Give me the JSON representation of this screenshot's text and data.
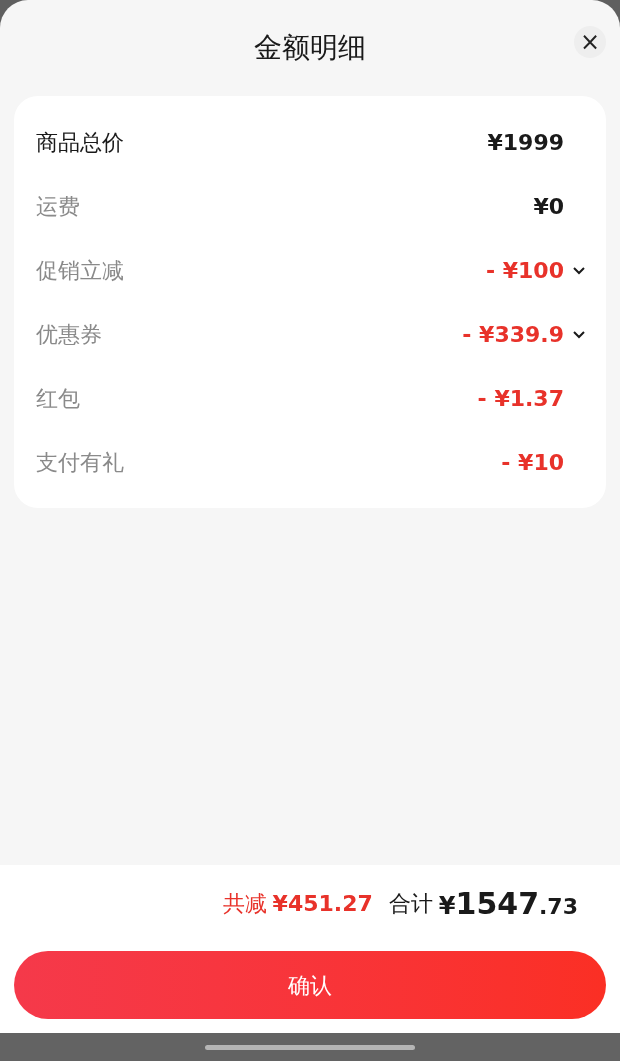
{
  "sheet": {
    "title": "金额明细",
    "close_glyph": "×"
  },
  "rows": [
    {
      "label": "商品总价",
      "value": "¥1999",
      "kind": "total",
      "expandable": false
    },
    {
      "label": "运费",
      "value": "¥0",
      "kind": "fee",
      "expandable": false
    },
    {
      "label": "促销立减",
      "value": "- ¥100",
      "kind": "discount",
      "expandable": true
    },
    {
      "label": "优惠券",
      "value": "- ¥339.9",
      "kind": "discount",
      "expandable": true
    },
    {
      "label": "红包",
      "value": "- ¥1.37",
      "kind": "discount",
      "expandable": false
    },
    {
      "label": "支付有礼",
      "value": "- ¥10",
      "kind": "discount",
      "expandable": false
    }
  ],
  "summary": {
    "saved_label": "共减",
    "saved_amount": "¥451.27",
    "total_label": "合计",
    "total_currency": "¥",
    "total_integer": "1547",
    "total_decimal": ".73"
  },
  "confirm_button": "确认"
}
